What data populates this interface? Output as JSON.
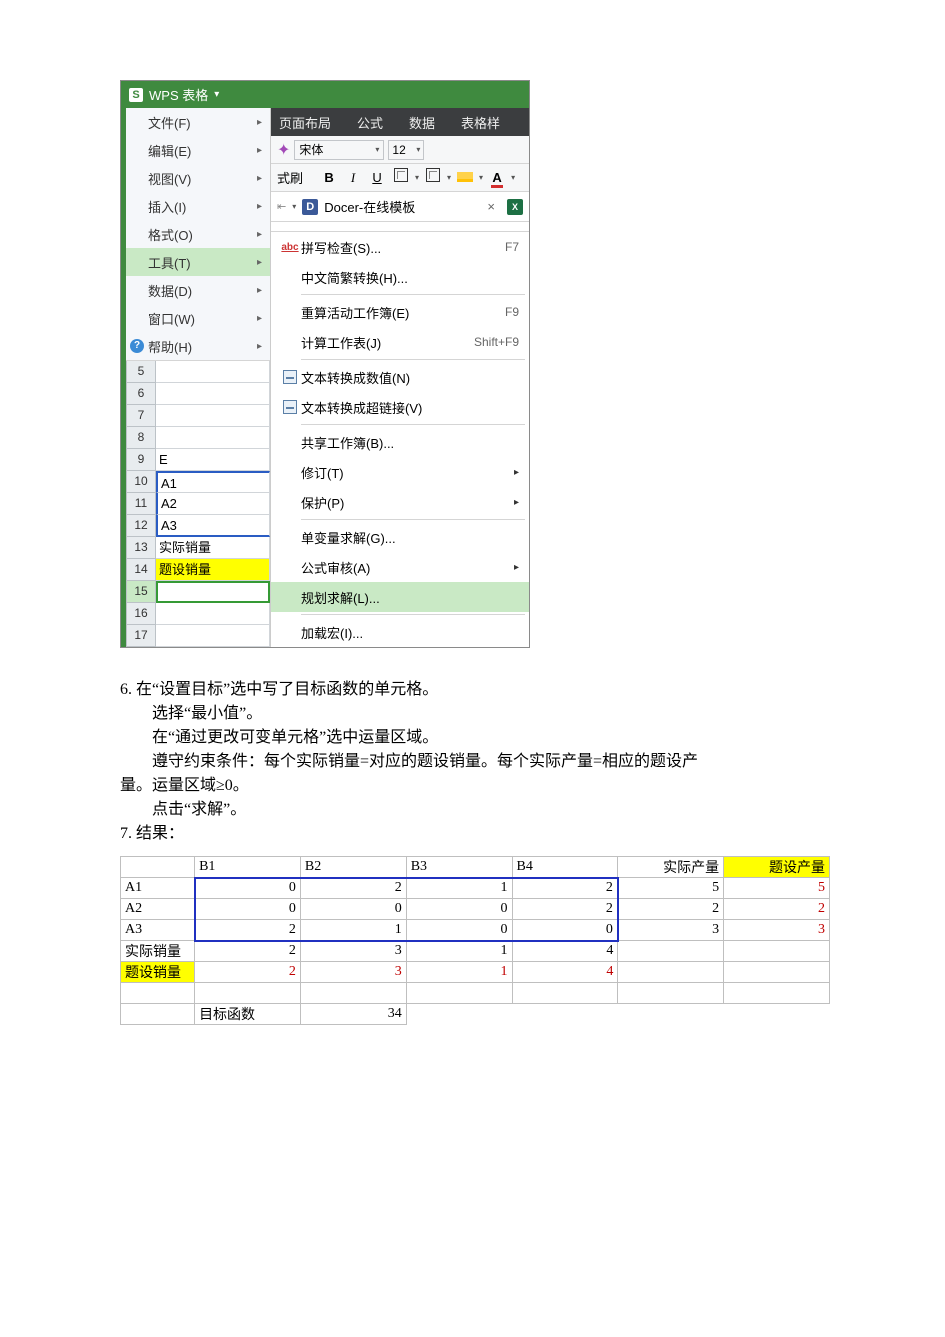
{
  "wps": {
    "title": "WPS 表格",
    "file_menu": [
      {
        "label": "文件(F)"
      },
      {
        "label": "编辑(E)"
      },
      {
        "label": "视图(V)"
      },
      {
        "label": "插入(I)"
      },
      {
        "label": "格式(O)"
      },
      {
        "label": "工具(T)",
        "selected": true
      },
      {
        "label": "数据(D)"
      },
      {
        "label": "窗口(W)"
      },
      {
        "label": "帮助(H)",
        "help": true
      }
    ],
    "tabs": [
      "页面布局",
      "公式",
      "数据",
      "表格样"
    ],
    "font": "宋体",
    "size": "12",
    "brush": "式刷",
    "docer": "Docer-在线模板",
    "sheet_rows": [
      {
        "n": "5",
        "cell": ""
      },
      {
        "n": "6",
        "cell": ""
      },
      {
        "n": "7",
        "cell": ""
      },
      {
        "n": "8",
        "cell": ""
      },
      {
        "n": "9",
        "cell": "E"
      },
      {
        "n": "10",
        "cell": "A1"
      },
      {
        "n": "11",
        "cell": "A2"
      },
      {
        "n": "12",
        "cell": "A3"
      },
      {
        "n": "13",
        "cell": "实际销量"
      },
      {
        "n": "14",
        "cell": "题设销量",
        "yellow": true
      },
      {
        "n": "15",
        "cell": "",
        "sel": true
      },
      {
        "n": "16",
        "cell": ""
      },
      {
        "n": "17",
        "cell": ""
      }
    ],
    "tools_menu": [
      {
        "label": "拼写检查(S)...",
        "shortcut": "F7",
        "icon": "abc"
      },
      {
        "label": "中文简繁转换(H)..."
      },
      {
        "sep": true
      },
      {
        "label": "重算活动工作簿(E)",
        "shortcut": "F9"
      },
      {
        "label": "计算工作表(J)",
        "shortcut": "Shift+F9"
      },
      {
        "sep": true
      },
      {
        "label": "文本转换成数值(N)",
        "icon": "conv"
      },
      {
        "label": "文本转换成超链接(V)",
        "icon": "conv"
      },
      {
        "sep": true
      },
      {
        "label": "共享工作簿(B)..."
      },
      {
        "label": "修订(T)",
        "arrow": true
      },
      {
        "label": "保护(P)",
        "arrow": true
      },
      {
        "sep": true
      },
      {
        "label": "单变量求解(G)..."
      },
      {
        "label": "公式审核(A)",
        "arrow": true
      },
      {
        "label": "规划求解(L)...",
        "selected": true
      },
      {
        "sep": true
      },
      {
        "label": "加载宏(I)..."
      }
    ]
  },
  "para": {
    "l1": "6. 在“设置目标”选中写了目标函数的单元格。",
    "l2": "选择“最小值”。",
    "l3": "在“通过更改可变单元格”选中运量区域。",
    "l4": "遵守约束条件：每个实际销量=对应的题设销量。每个实际产量=相应的题设产",
    "l4b": "量。运量区域≥0。",
    "l5": "点击“求解”。",
    "l6": "7. 结果："
  },
  "result": {
    "cols": [
      "",
      "B1",
      "B2",
      "B3",
      "B4",
      "实际产量",
      "题设产量"
    ],
    "rows": [
      {
        "h": "A1",
        "v": [
          "0",
          "2",
          "1",
          "2",
          "5",
          "5"
        ]
      },
      {
        "h": "A2",
        "v": [
          "0",
          "0",
          "0",
          "2",
          "2",
          "2"
        ]
      },
      {
        "h": "A3",
        "v": [
          "2",
          "1",
          "0",
          "0",
          "3",
          "3"
        ]
      },
      {
        "h": "实际销量",
        "v": [
          "2",
          "3",
          "1",
          "4",
          "",
          ""
        ]
      },
      {
        "h": "题设销量",
        "v": [
          "2",
          "3",
          "1",
          "4",
          "",
          ""
        ],
        "yellow": true,
        "red": true
      }
    ],
    "obj_label": "目标函数",
    "obj_value": "34"
  },
  "chart_data": {
    "type": "table",
    "title": "运输问题规划求解结果",
    "columns": [
      "",
      "B1",
      "B2",
      "B3",
      "B4",
      "实际产量",
      "题设产量"
    ],
    "rows": [
      [
        "A1",
        0,
        2,
        1,
        2,
        5,
        5
      ],
      [
        "A2",
        0,
        0,
        0,
        2,
        2,
        2
      ],
      [
        "A3",
        2,
        1,
        0,
        0,
        3,
        3
      ],
      [
        "实际销量",
        2,
        3,
        1,
        4,
        null,
        null
      ],
      [
        "题设销量",
        2,
        3,
        1,
        4,
        null,
        null
      ]
    ],
    "objective": {
      "label": "目标函数",
      "value": 34
    }
  }
}
